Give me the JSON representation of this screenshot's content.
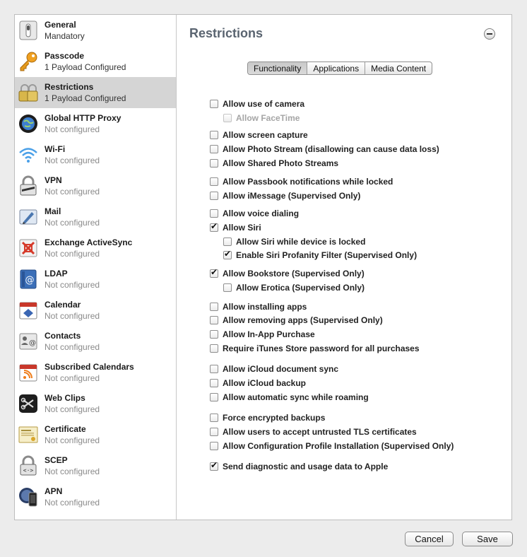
{
  "sidebar": {
    "items": [
      {
        "name": "General",
        "status": "Mandatory",
        "icon": "switch-icon"
      },
      {
        "name": "Passcode",
        "status": "1 Payload Configured",
        "icon": "key-icon"
      },
      {
        "name": "Restrictions",
        "status": "1 Payload Configured",
        "icon": "padlocks-icon"
      },
      {
        "name": "Global HTTP Proxy",
        "status": "Not configured",
        "icon": "globe-icon"
      },
      {
        "name": "Wi-Fi",
        "status": "Not configured",
        "icon": "wifi-icon"
      },
      {
        "name": "VPN",
        "status": "Not configured",
        "icon": "vpn-lock-icon"
      },
      {
        "name": "Mail",
        "status": "Not configured",
        "icon": "mail-icon"
      },
      {
        "name": "Exchange ActiveSync",
        "status": "Not configured",
        "icon": "exchange-icon"
      },
      {
        "name": "LDAP",
        "status": "Not configured",
        "icon": "ldap-icon"
      },
      {
        "name": "Calendar",
        "status": "Not configured",
        "icon": "calendar-icon"
      },
      {
        "name": "Contacts",
        "status": "Not configured",
        "icon": "contacts-icon"
      },
      {
        "name": "Subscribed Calendars",
        "status": "Not configured",
        "icon": "subscribed-calendar-icon"
      },
      {
        "name": "Web Clips",
        "status": "Not configured",
        "icon": "web-clip-icon"
      },
      {
        "name": "Certificate",
        "status": "Not configured",
        "icon": "certificate-icon"
      },
      {
        "name": "SCEP",
        "status": "Not configured",
        "icon": "scep-icon"
      },
      {
        "name": "APN",
        "status": "Not configured",
        "icon": "apn-icon"
      }
    ]
  },
  "main": {
    "title": "Restrictions",
    "tabs": [
      "Functionality",
      "Applications",
      "Media Content"
    ],
    "active_tab": "Functionality",
    "options": [
      {
        "label": "Allow use of camera",
        "checked": false,
        "indent": 0,
        "disabled": false
      },
      {
        "label": "Allow FaceTime",
        "checked": false,
        "indent": 1,
        "disabled": true
      },
      {
        "label": "Allow screen capture",
        "checked": false,
        "indent": 0,
        "disabled": false
      },
      {
        "label": "Allow Photo Stream (disallowing can cause data loss)",
        "checked": false,
        "indent": 0,
        "disabled": false
      },
      {
        "label": "Allow Shared Photo Streams",
        "checked": false,
        "indent": 0,
        "disabled": false
      },
      {
        "label": "Allow Passbook notifications while locked",
        "checked": false,
        "indent": 0,
        "disabled": false
      },
      {
        "label": "Allow iMessage (Supervised Only)",
        "checked": false,
        "indent": 0,
        "disabled": false
      },
      {
        "label": "Allow voice dialing",
        "checked": false,
        "indent": 0,
        "disabled": false
      },
      {
        "label": "Allow Siri",
        "checked": true,
        "indent": 0,
        "disabled": false
      },
      {
        "label": "Allow Siri while device is locked",
        "checked": false,
        "indent": 1,
        "disabled": false
      },
      {
        "label": "Enable Siri Profanity Filter (Supervised Only)",
        "checked": true,
        "indent": 1,
        "disabled": false
      },
      {
        "label": "Allow Bookstore (Supervised Only)",
        "checked": true,
        "indent": 0,
        "disabled": false
      },
      {
        "label": "Allow Erotica (Supervised Only)",
        "checked": false,
        "indent": 1,
        "disabled": false
      },
      {
        "label": "Allow installing apps",
        "checked": false,
        "indent": 0,
        "disabled": false
      },
      {
        "label": "Allow removing apps (Supervised Only)",
        "checked": false,
        "indent": 0,
        "disabled": false
      },
      {
        "label": "Allow In-App Purchase",
        "checked": false,
        "indent": 0,
        "disabled": false
      },
      {
        "label": "Require iTunes Store password for all purchases",
        "checked": false,
        "indent": 0,
        "disabled": false
      },
      {
        "label": "Allow iCloud document sync",
        "checked": false,
        "indent": 0,
        "disabled": false
      },
      {
        "label": "Allow iCloud backup",
        "checked": false,
        "indent": 0,
        "disabled": false
      },
      {
        "label": "Allow automatic sync while roaming",
        "checked": false,
        "indent": 0,
        "disabled": false
      },
      {
        "label": "Force encrypted backups",
        "checked": false,
        "indent": 0,
        "disabled": false
      },
      {
        "label": "Allow users to accept untrusted TLS certificates",
        "checked": false,
        "indent": 0,
        "disabled": false
      },
      {
        "label": "Allow Configuration Profile Installation (Supervised Only)",
        "checked": false,
        "indent": 0,
        "disabled": false
      },
      {
        "label": "Send diagnostic and usage data to Apple",
        "checked": true,
        "indent": 0,
        "disabled": false
      }
    ]
  },
  "footer": {
    "cancel_label": "Cancel",
    "save_label": "Save"
  }
}
